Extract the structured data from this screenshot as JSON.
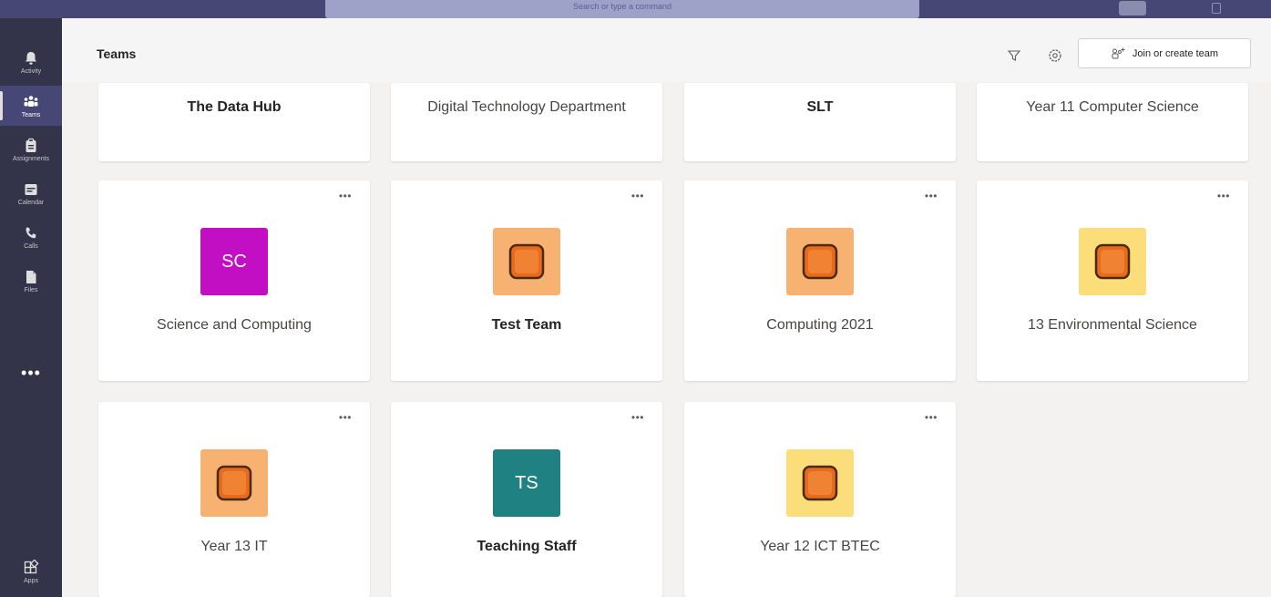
{
  "app": {
    "search_placeholder": "Search or type a command"
  },
  "rail": {
    "items": [
      {
        "label": "Activity",
        "icon": "bell-icon"
      },
      {
        "label": "Teams",
        "icon": "teams-icon",
        "active": true
      },
      {
        "label": "Assignments",
        "icon": "assignments-icon"
      },
      {
        "label": "Calendar",
        "icon": "calendar-icon"
      },
      {
        "label": "Calls",
        "icon": "phone-icon"
      },
      {
        "label": "Files",
        "icon": "files-icon"
      }
    ],
    "more": "•••",
    "apps_label": "Apps"
  },
  "header": {
    "title": "Teams",
    "join_label": "Join or create team"
  },
  "pinned_teams": [
    {
      "name": "The Data Hub",
      "bold": true
    },
    {
      "name": "Digital Technology Department",
      "bold": false
    },
    {
      "name": "SLT",
      "bold": true
    },
    {
      "name": "Year 11 Computer Science",
      "bold": false
    }
  ],
  "teams": [
    {
      "name": "Science and Computing",
      "tile_text": "SC",
      "tile_color": "#c30fc3",
      "bold": false
    },
    {
      "name": "Test Team",
      "tile_text": "",
      "tile_color": "#f7b272",
      "bold": true
    },
    {
      "name": "Computing 2021",
      "tile_text": "",
      "tile_color": "#f7b272",
      "bold": false
    },
    {
      "name": "13 Environmental Science",
      "tile_text": "",
      "tile_color": "#fbde7a",
      "bold": false
    },
    {
      "name": "Year 13 IT",
      "tile_text": "",
      "tile_color": "#f7b272",
      "bold": false
    },
    {
      "name": "Teaching Staff",
      "tile_text": "TS",
      "tile_color": "#1f8181",
      "bold": true
    },
    {
      "name": "Year 12 ICT BTEC",
      "tile_text": "",
      "tile_color": "#fbde7a",
      "bold": false
    }
  ],
  "card_more": "•••",
  "colors": {
    "rail": "#33344a",
    "topbar": "#464775",
    "accent": "#6264a7"
  }
}
